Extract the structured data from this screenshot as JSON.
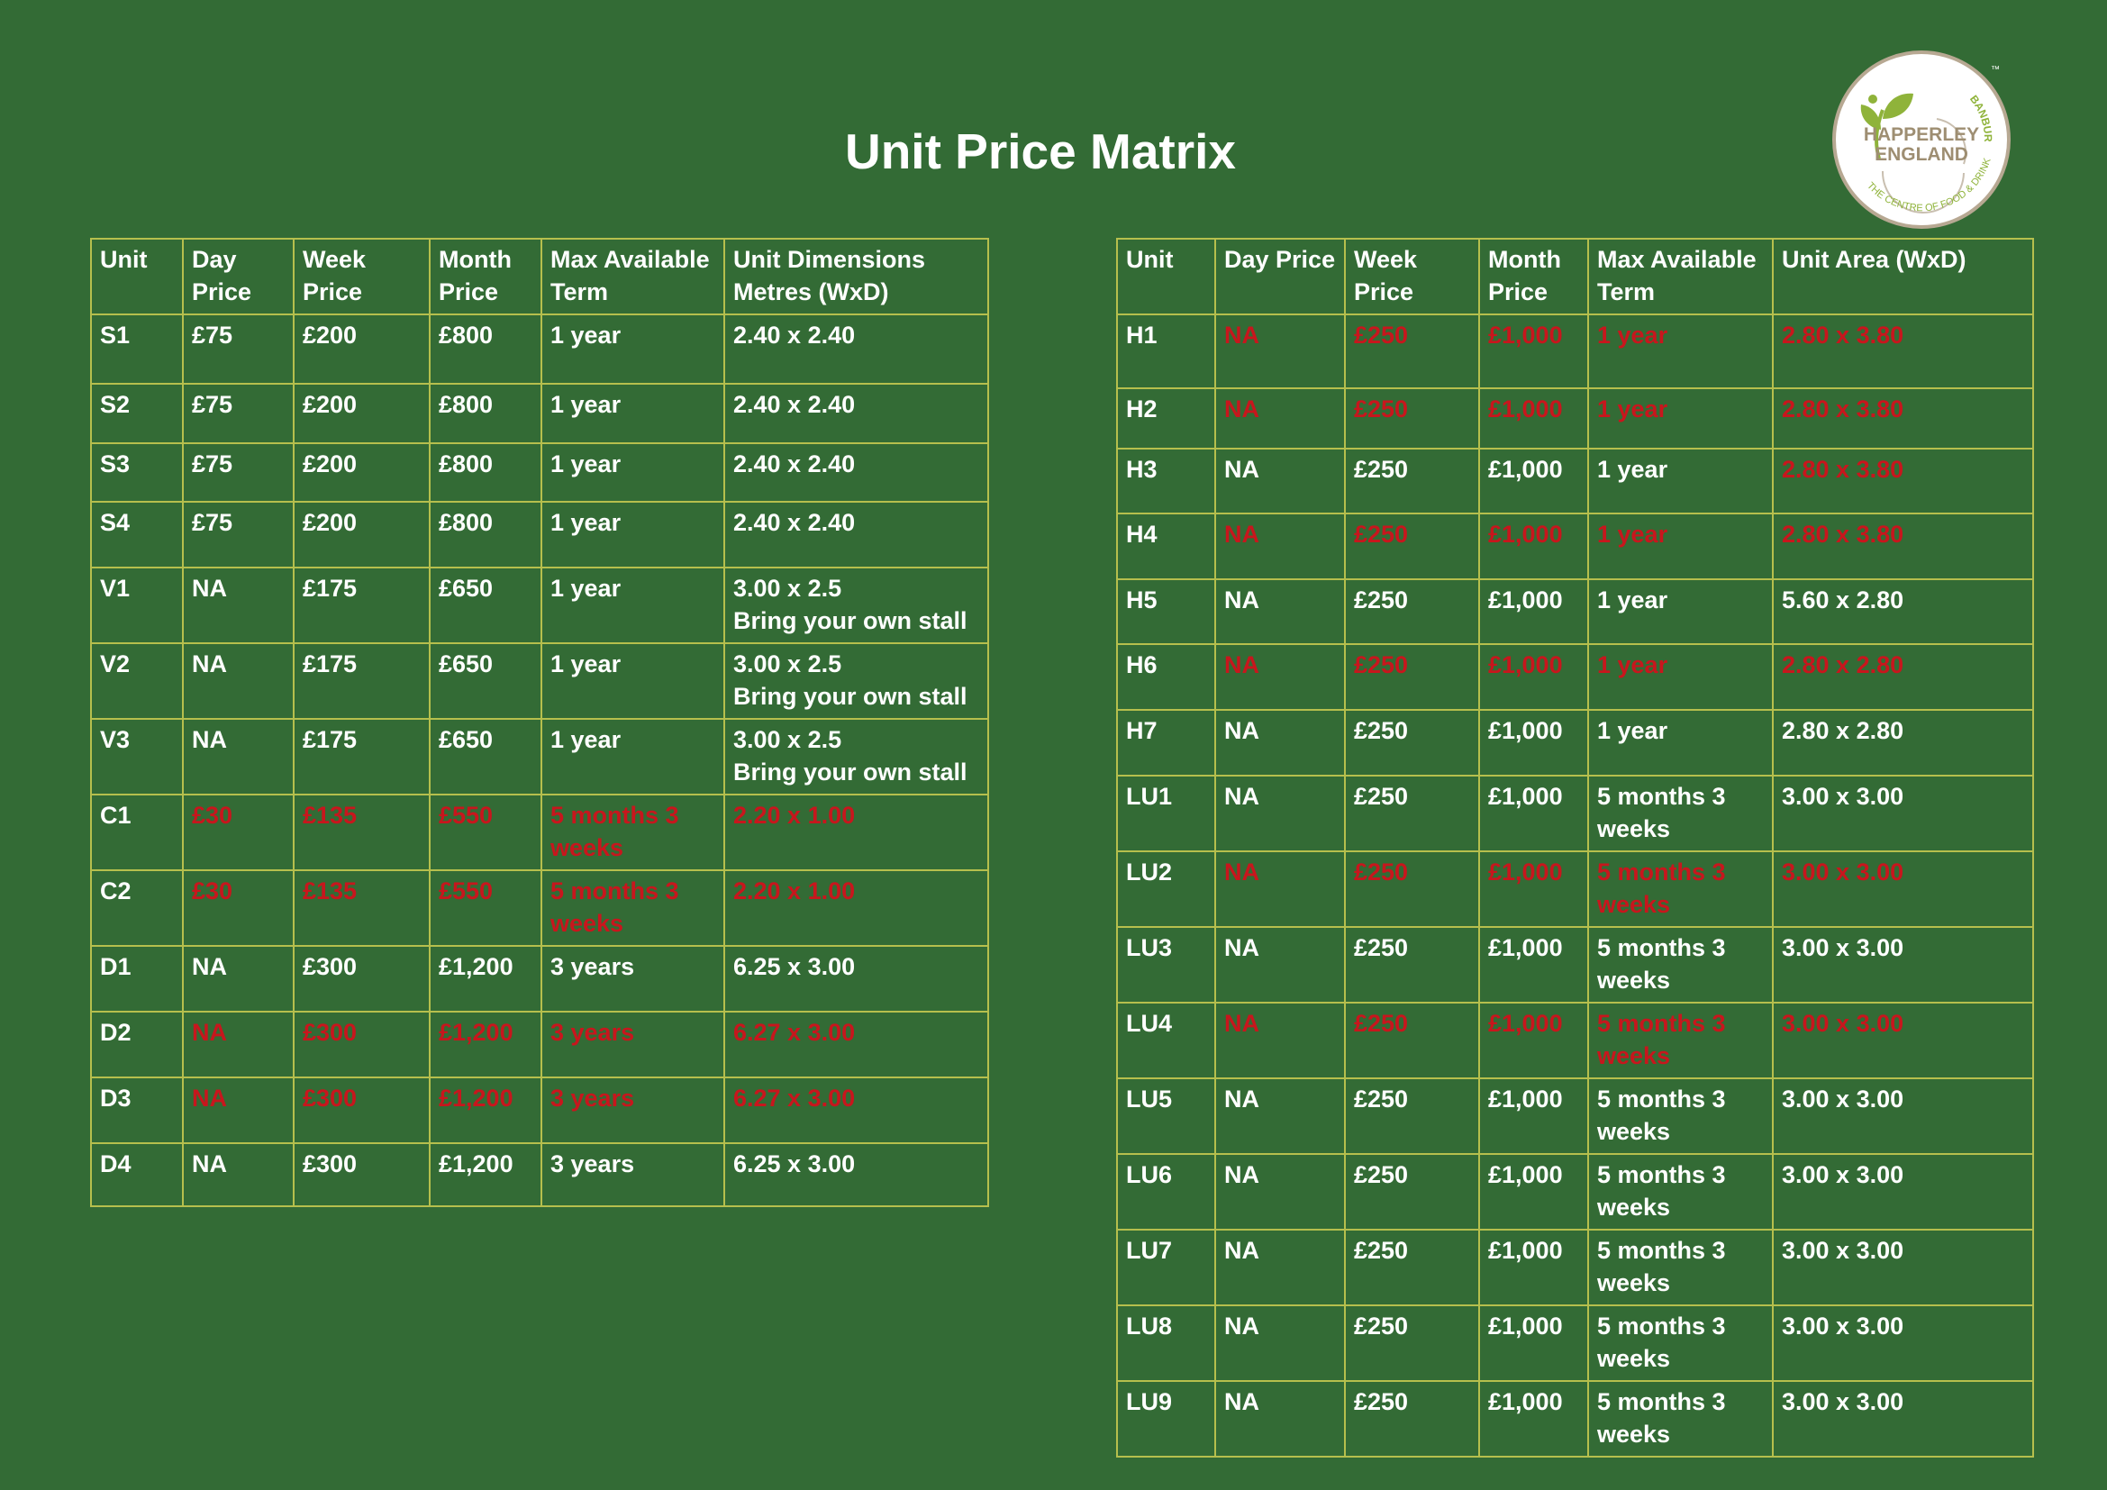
{
  "title": "Unit Price Matrix",
  "logo": {
    "top_text": "BANBURY",
    "name_line1": "HAPPERLEY",
    "name_line2": "ENGLAND",
    "bottom_text": "THE CENTRE OF FOOD & DRINK",
    "tm": "™"
  },
  "colors": {
    "background": "#336b35",
    "grid": "#b6bf4d",
    "text": "#ffffff",
    "unavailable": "#c8161d"
  },
  "left_table": {
    "headers": [
      "Unit",
      "Day Price",
      "Week Price",
      "Month Price",
      "Max Available Term",
      "Unit Dimensions Metres (WxD)"
    ],
    "rows": [
      {
        "unit": "S1",
        "day": "£75",
        "week": "£200",
        "month": "£800",
        "term": "1 year",
        "dims": "2.40 x 2.40",
        "red": false
      },
      {
        "unit": "S2",
        "day": "£75",
        "week": "£200",
        "month": "£800",
        "term": "1 year",
        "dims": "2.40 x 2.40",
        "red": false
      },
      {
        "unit": "S3",
        "day": "£75",
        "week": "£200",
        "month": "£800",
        "term": "1 year",
        "dims": "2.40 x 2.40",
        "red": false
      },
      {
        "unit": "S4",
        "day": "£75",
        "week": "£200",
        "month": "£800",
        "term": "1 year",
        "dims": "2.40 x 2.40",
        "red": false
      },
      {
        "unit": "V1",
        "day": "NA",
        "week": "£175",
        "month": "£650",
        "term": "1 year",
        "dims": "3.00 x 2.5",
        "note": "Bring your own stall",
        "red": false
      },
      {
        "unit": "V2",
        "day": "NA",
        "week": "£175",
        "month": "£650",
        "term": "1 year",
        "dims": "3.00 x 2.5",
        "note": "Bring your own stall",
        "red": false
      },
      {
        "unit": "V3",
        "day": "NA",
        "week": "£175",
        "month": "£650",
        "term": "1 year",
        "dims": "3.00 x 2.5",
        "note": "Bring your own stall",
        "red": false
      },
      {
        "unit": "C1",
        "day": "£30",
        "week": "£135",
        "month": "£550",
        "term": "5 months 3 weeks",
        "dims": "2.20 x 1.00",
        "red": true
      },
      {
        "unit": "C2",
        "day": "£30",
        "week": "£135",
        "month": "£550",
        "term": "5 months 3 weeks",
        "dims": "2.20 x 1.00",
        "red": true
      },
      {
        "unit": "D1",
        "day": "NA",
        "week": "£300",
        "month": "£1,200",
        "term": "3 years",
        "dims": "6.25 x 3.00",
        "red": false
      },
      {
        "unit": "D2",
        "day": "NA",
        "week": "£300",
        "month": "£1,200",
        "term": "3 years",
        "dims": "6.27 x 3.00",
        "red": true
      },
      {
        "unit": "D3",
        "day": "NA",
        "week": "£300",
        "month": "£1,200",
        "term": "3 years",
        "dims": "6.27 x 3.00",
        "red": true
      },
      {
        "unit": "D4",
        "day": "NA",
        "week": "£300",
        "month": "£1,200",
        "term": "3 years",
        "dims": "6.25 x 3.00",
        "red": false
      }
    ]
  },
  "right_table": {
    "headers": [
      "Unit",
      "Day Price",
      "Week Price",
      "Month Price",
      "Max Available Term",
      "Unit Area (WxD)"
    ],
    "rows": [
      {
        "unit": "H1",
        "day": "NA",
        "week": "£250",
        "month": "£1,000",
        "term": "1 year",
        "dims": "2.80 x 3.80",
        "red": true
      },
      {
        "unit": "H2",
        "day": "NA",
        "week": "£250",
        "month": "£1,000",
        "term": "1 year",
        "dims": "2.80 x 3.80",
        "red": true
      },
      {
        "unit": "H3",
        "day": "NA",
        "week": "£250",
        "month": "£1,000",
        "term": "1 year",
        "dims": "2.80 x 3.80",
        "red": false,
        "red_dims": true
      },
      {
        "unit": "H4",
        "day": "NA",
        "week": "£250",
        "month": "£1,000",
        "term": "1 year",
        "dims": "2.80 x 3.80",
        "red": true
      },
      {
        "unit": "H5",
        "day": "NA",
        "week": "£250",
        "month": "£1,000",
        "term": "1 year",
        "dims": "5.60 x 2.80",
        "red": false
      },
      {
        "unit": "H6",
        "day": "NA",
        "week": "£250",
        "month": "£1,000",
        "term": "1 year",
        "dims": "2.80 x 2.80",
        "red": true
      },
      {
        "unit": "H7",
        "day": "NA",
        "week": "£250",
        "month": "£1,000",
        "term": "1 year",
        "dims": "2.80 x 2.80",
        "red": false
      },
      {
        "unit": "LU1",
        "day": "NA",
        "week": "£250",
        "month": "£1,000",
        "term": "5 months 3 weeks",
        "dims": "3.00 x 3.00",
        "red": false
      },
      {
        "unit": "LU2",
        "day": "NA",
        "week": "£250",
        "month": "£1,000",
        "term": "5 months 3 weeks",
        "dims": "3.00 x 3.00",
        "red": true
      },
      {
        "unit": "LU3",
        "day": "NA",
        "week": "£250",
        "month": "£1,000",
        "term": "5 months 3 weeks",
        "dims": "3.00 x 3.00",
        "red": false
      },
      {
        "unit": "LU4",
        "day": "NA",
        "week": "£250",
        "month": "£1,000",
        "term": "5 months 3 weeks",
        "dims": "3.00 x 3.00",
        "red": true
      },
      {
        "unit": "LU5",
        "day": "NA",
        "week": "£250",
        "month": "£1,000",
        "term": "5 months 3 weeks",
        "dims": "3.00 x 3.00",
        "red": false
      },
      {
        "unit": "LU6",
        "day": "NA",
        "week": "£250",
        "month": "£1,000",
        "term": "5 months 3 weeks",
        "dims": "3.00 x 3.00",
        "red": false
      },
      {
        "unit": "LU7",
        "day": "NA",
        "week": "£250",
        "month": "£1,000",
        "term": "5 months 3 weeks",
        "dims": "3.00 x 3.00",
        "red": false
      },
      {
        "unit": "LU8",
        "day": "NA",
        "week": "£250",
        "month": "£1,000",
        "term": "5 months 3 weeks",
        "dims": "3.00 x 3.00",
        "red": false
      },
      {
        "unit": "LU9",
        "day": "NA",
        "week": "£250",
        "month": "£1,000",
        "term": "5 months 3 weeks",
        "dims": "3.00 x 3.00",
        "red": false
      }
    ]
  }
}
